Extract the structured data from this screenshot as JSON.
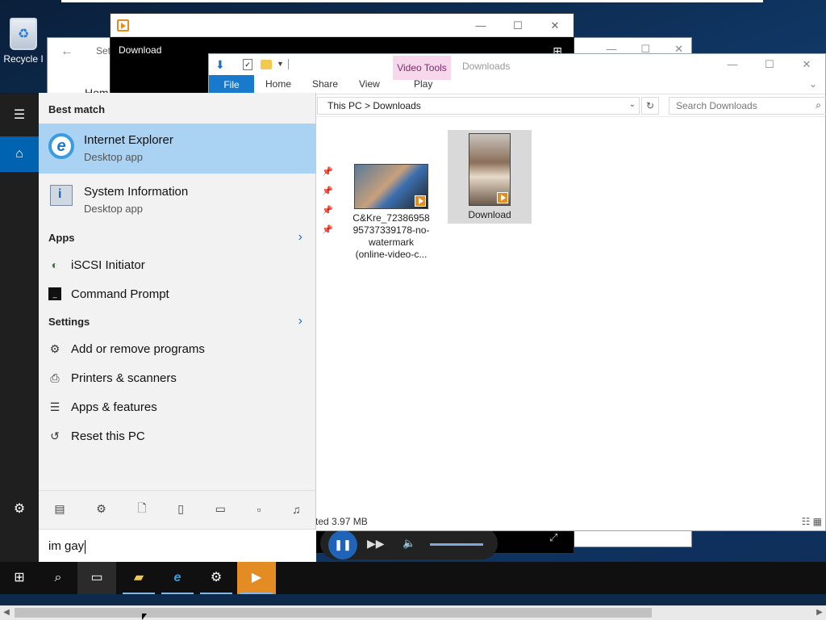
{
  "desktop": {
    "recycle_bin_label": "Recycle I"
  },
  "settings_window": {
    "title": "Set",
    "home_label": "Hom"
  },
  "video_window": {
    "title": "Download",
    "player": {
      "play_state": "pause"
    }
  },
  "explorer": {
    "ribbon_context_tab": "Video Tools",
    "title": "Downloads",
    "tabs": [
      "File",
      "Home",
      "Share",
      "View",
      "Play"
    ],
    "breadcrumb": {
      "root": "This PC",
      "sep": ">",
      "folder": "Downloads"
    },
    "search_placeholder": "Search Downloads",
    "files": [
      {
        "name": "C&Kre_72386958\n95737339178-no-\nwatermark\n(online-video-c...",
        "selected": false
      },
      {
        "name": "Download",
        "selected": true
      }
    ],
    "status": "ted  3.97 MB"
  },
  "start_menu": {
    "best_match_heading": "Best match",
    "best_match": {
      "name": "Internet Explorer",
      "subtitle": "Desktop app"
    },
    "second_result": {
      "name": "System Information",
      "subtitle": "Desktop app"
    },
    "apps_heading": "Apps",
    "apps": [
      {
        "label": "iSCSI Initiator",
        "icon": "globe-icon"
      },
      {
        "label": "Command Prompt",
        "icon": "terminal-icon"
      }
    ],
    "settings_heading": "Settings",
    "settings": [
      {
        "label": "Add or remove programs",
        "icon": "gear-icon"
      },
      {
        "label": "Printers & scanners",
        "icon": "printer-icon"
      },
      {
        "label": "Apps & features",
        "icon": "list-icon"
      },
      {
        "label": "Reset this PC",
        "icon": "reset-icon"
      }
    ],
    "search_query": "im gay"
  },
  "colors": {
    "accent": "#0063b1",
    "best_match_bg": "#a9d2f3",
    "video_orange": "#e38c24",
    "ribbon_blue": "#1979ca"
  }
}
